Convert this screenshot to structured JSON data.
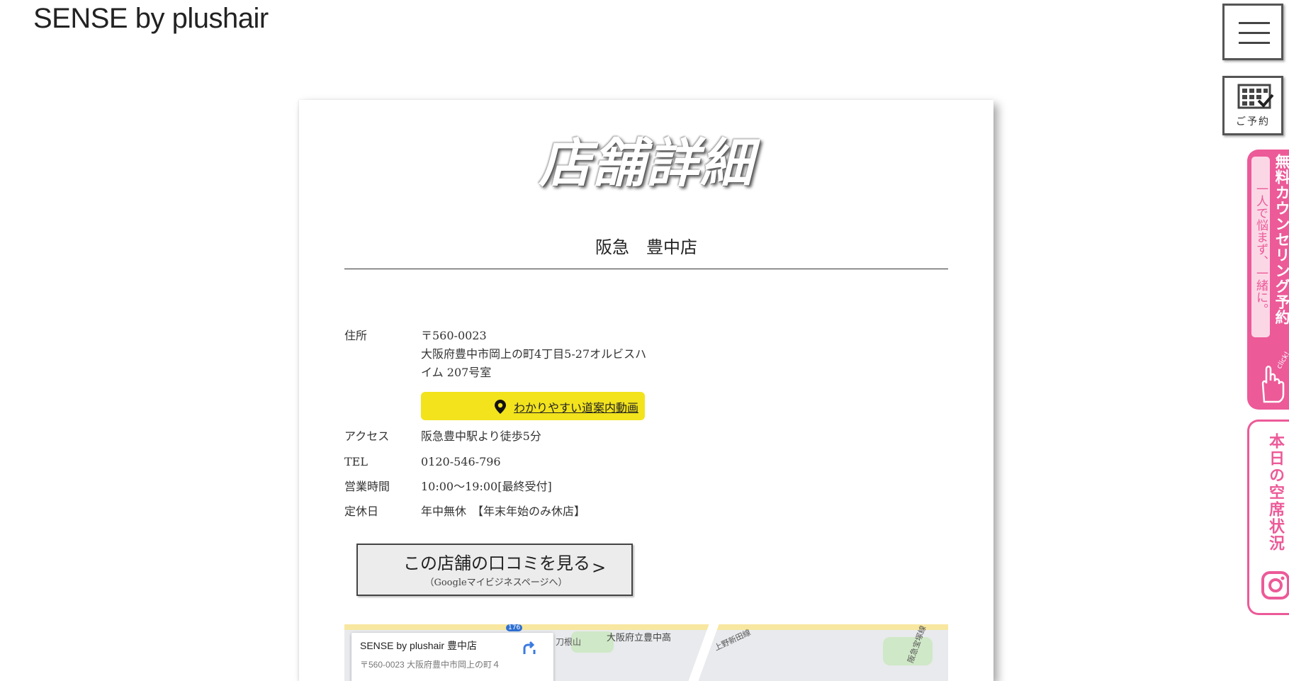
{
  "header": {
    "logo": "SENSE by plushair"
  },
  "side": {
    "reserve_label": "ご予約",
    "counseling_main": "無料カウンセリング予約",
    "counseling_sub": "一人で悩まず、一緒に。",
    "counseling_click": "click!",
    "vacancy_label": "本日の空席状況"
  },
  "page": {
    "title": "店舗詳細",
    "store_name": "阪急　豊中店"
  },
  "info": {
    "address_label": "住所",
    "postal": "〒560-0023",
    "address": "大阪府豊中市岡上の町4丁目5-27オルビスハイム 207号室",
    "video_button": "わかりやすい道案内動画",
    "access_label": "アクセス",
    "access": "阪急豊中駅より徒歩5分",
    "tel_label": "TEL",
    "tel": "0120-546-796",
    "hours_label": "営業時間",
    "hours": "10:00〜19:00[最終受付]",
    "holiday_label": "定休日",
    "holiday": "年中無休　【年末年始のみ休店】"
  },
  "review_button": {
    "main": "この店舗の口コミを見る",
    "sub": "（Googleマイビジネスページへ）",
    "arrow": ">"
  },
  "map": {
    "place_title": "SENSE by plushair 豊中店",
    "place_address": "〒560-0023 大阪府豊中市岡上の町４",
    "label_school": "大阪府立豊中高",
    "label_area": "刀根山",
    "label_line": "上野新田線",
    "label_rail": "阪急宝塚線",
    "label_route": "176"
  }
}
